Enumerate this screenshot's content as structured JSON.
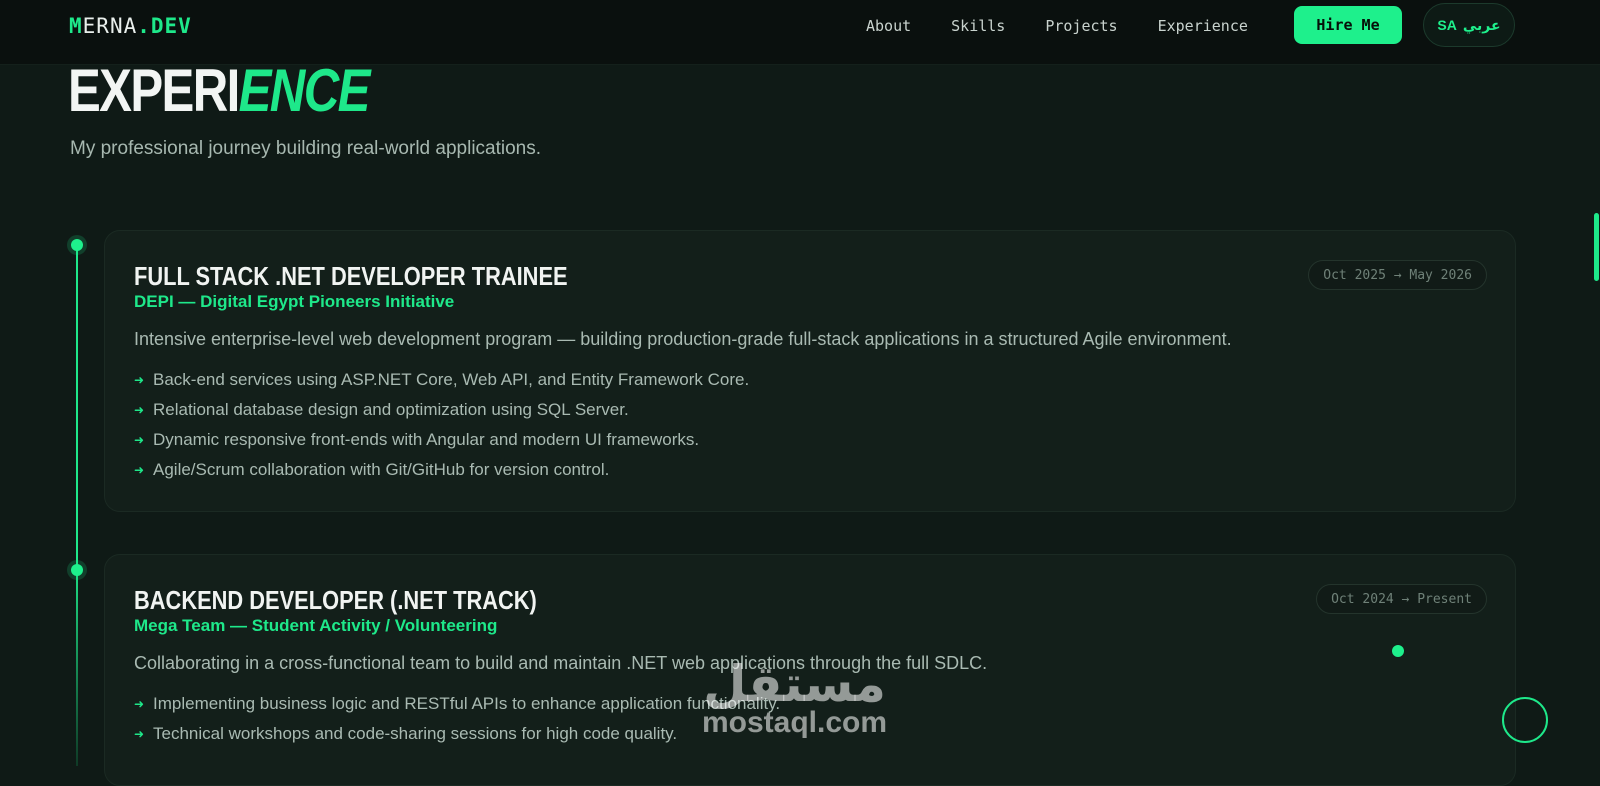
{
  "nav": {
    "logo": {
      "m": "M",
      "erna": "ERNA",
      "dot": ".",
      "dev": "DEV"
    },
    "links": [
      "About",
      "Skills",
      "Projects",
      "Experience"
    ],
    "hire_label": "Hire Me",
    "lang": {
      "code": "SA",
      "label": "عربي"
    }
  },
  "header": {
    "title_part1": "EXPERI",
    "title_part2": "ENCE",
    "subtitle": "My professional journey building real-world applications."
  },
  "experience": [
    {
      "title": "FULL STACK .NET DEVELOPER TRAINEE",
      "org": "DEPI — Digital Egypt Pioneers Initiative",
      "date": "Oct 2025 → May 2026",
      "description": "Intensive enterprise-level web development program — building production-grade full-stack applications in a structured Agile environment.",
      "bullets": [
        "Back-end services using ASP.NET Core, Web API, and Entity Framework Core.",
        "Relational database design and optimization using SQL Server.",
        "Dynamic responsive front-ends with Angular and modern UI frameworks.",
        "Agile/Scrum collaboration with Git/GitHub for version control."
      ]
    },
    {
      "title": "BACKEND DEVELOPER (.NET TRACK)",
      "org": "Mega Team — Student Activity / Volunteering",
      "date": "Oct 2024 → Present",
      "description": "Collaborating in a cross-functional team to build and maintain .NET web applications through the full SDLC.",
      "bullets": [
        "Implementing business logic and RESTful APIs to enhance application functionality.",
        "Technical workshops and code-sharing sessions for high code quality."
      ]
    }
  ],
  "watermark": {
    "arabic": "مستقل",
    "latin": "mostaql.com"
  },
  "colors": {
    "accent": "#1ee88a",
    "background": "#0f1a16",
    "card": "#131f1a"
  }
}
